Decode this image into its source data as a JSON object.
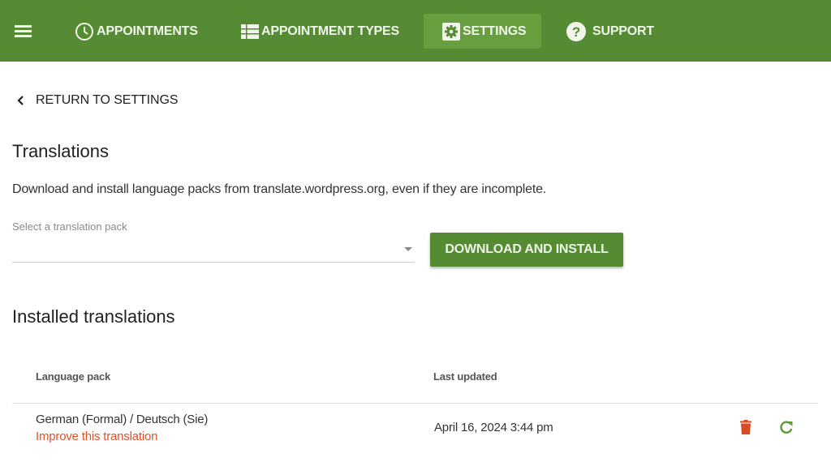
{
  "topbar": {
    "menu_icon": "hamburger-menu-icon",
    "nav": [
      {
        "label": "APPOINTMENTS",
        "icon": "clock-icon",
        "active": false
      },
      {
        "label": "APPOINTMENT TYPES",
        "icon": "list-icon",
        "active": false
      },
      {
        "label": "SETTINGS",
        "icon": "gear-icon",
        "active": true
      },
      {
        "label": "SUPPORT",
        "icon": "help-circle-icon",
        "active": false
      }
    ]
  },
  "back_link": {
    "label": "RETURN TO SETTINGS",
    "icon": "chevron-left-icon"
  },
  "translations": {
    "title": "Translations",
    "description": "Download and install language packs from translate.wordpress.org, even if they are incomplete.",
    "select": {
      "label": "Select a translation pack",
      "value": ""
    },
    "download_button": "DOWNLOAD AND INSTALL"
  },
  "installed": {
    "title": "Installed translations",
    "columns": [
      "Language pack",
      "Last updated"
    ],
    "rows": [
      {
        "language": "German (Formal) / Deutsch (Sie)",
        "improve_link": "Improve this translation",
        "last_updated": "April 16, 2024 3:44 pm",
        "actions": [
          "trash-icon",
          "refresh-icon"
        ]
      }
    ]
  },
  "colors": {
    "brand_green": "#558b32",
    "active_tab": "#689f3e",
    "link_red": "#e2512b",
    "delete_red": "#d84a22",
    "refresh_green": "#5b9a35"
  }
}
